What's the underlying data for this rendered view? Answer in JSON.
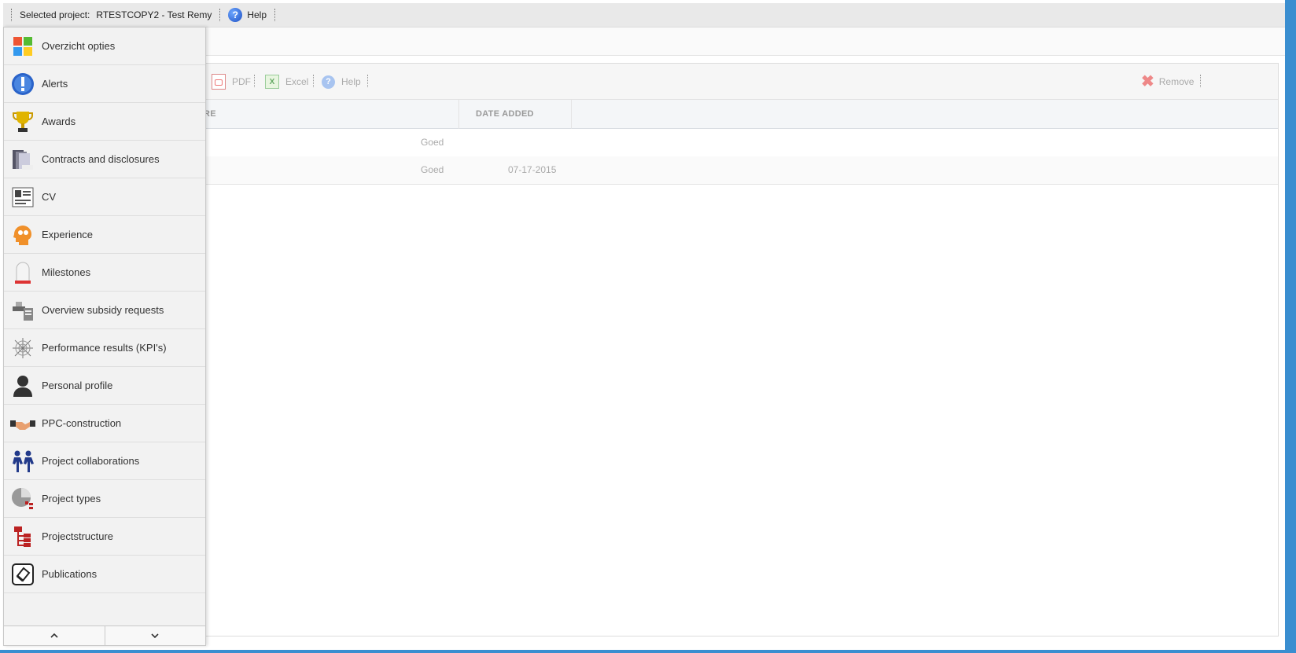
{
  "topbar": {
    "selected_label": "Selected project:",
    "project_name": "RTESTCOPY2 - Test Remy",
    "help_label": "Help"
  },
  "toolbar": {
    "pdf_label": "PDF",
    "excel_label": "Excel",
    "help_label": "Help",
    "remove_label": "Remove"
  },
  "grid": {
    "columns": [
      "RE",
      "DATE ADDED"
    ],
    "rows": [
      {
        "score": "Goed",
        "date": ""
      },
      {
        "score": "Goed",
        "date": "07-17-2015"
      }
    ]
  },
  "sidebar": {
    "items": [
      {
        "label": "Overzicht opties",
        "icon": "windows-tiles-icon"
      },
      {
        "label": "Alerts",
        "icon": "alert-icon"
      },
      {
        "label": "Awards",
        "icon": "trophy-icon"
      },
      {
        "label": "Contracts and disclosures",
        "icon": "binder-icon"
      },
      {
        "label": "CV",
        "icon": "cv-icon"
      },
      {
        "label": "Experience",
        "icon": "head-gears-icon"
      },
      {
        "label": "Milestones",
        "icon": "milestone-icon"
      },
      {
        "label": "Overview subsidy requests",
        "icon": "hand-document-icon"
      },
      {
        "label": "Performance results (KPI's)",
        "icon": "radar-icon"
      },
      {
        "label": "Personal profile",
        "icon": "person-icon"
      },
      {
        "label": "PPC-construction",
        "icon": "handshake-icon"
      },
      {
        "label": "Project collaborations",
        "icon": "people-icon"
      },
      {
        "label": "Project types",
        "icon": "pie-tree-icon"
      },
      {
        "label": "Projectstructure",
        "icon": "tree-structure-icon"
      },
      {
        "label": "Publications",
        "icon": "publication-icon"
      }
    ],
    "up_label": "⌃",
    "down_label": "⌄"
  }
}
